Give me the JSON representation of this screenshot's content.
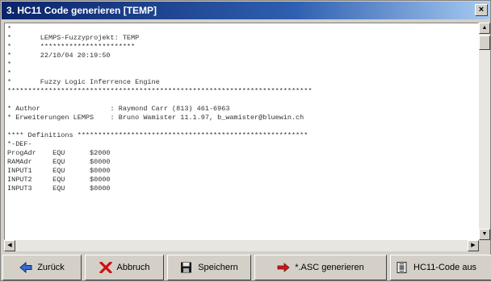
{
  "window": {
    "title": "3. HC11 Code generieren [TEMP]"
  },
  "editor": {
    "lines": [
      "*",
      "*       LEMPS-Fuzzyprojekt: TEMP",
      "*       ***********************",
      "*       22/10/04 20:19:50",
      "*",
      "*",
      "*       Fuzzy Logic Inferrence Engine",
      "**************************************************************************",
      "",
      "* Author                 : Raymond Carr (813) 461-6963",
      "* Erweiterungen LEMPS    : Bruno Wamister 11.1.97, b_wamister@bluewin.ch",
      "",
      "**** Definitions ********************************************************",
      "*-DEF-",
      "ProgAdr    EQU      $2000",
      "RAMAdr     EQU      $0000",
      "INPUT1     EQU      $0000",
      "INPUT2     EQU      $0000",
      "INPUT3     EQU      $0000"
    ]
  },
  "buttons": {
    "back": "Zurück",
    "cancel": "Abbruch",
    "save": "Speichern",
    "asc": "*.ASC generieren",
    "hc11": "HC11-Code aus"
  },
  "icons": {
    "close": "close-icon",
    "back": "arrow-left-icon",
    "cancel": "x-icon",
    "save": "floppy-disk-icon",
    "asc": "arrow-right-icon",
    "hc11": "document-chip-icon"
  },
  "colors": {
    "title_bar": "#0a246a",
    "cancel_red": "#d01010",
    "arrow_red": "#c81818"
  }
}
